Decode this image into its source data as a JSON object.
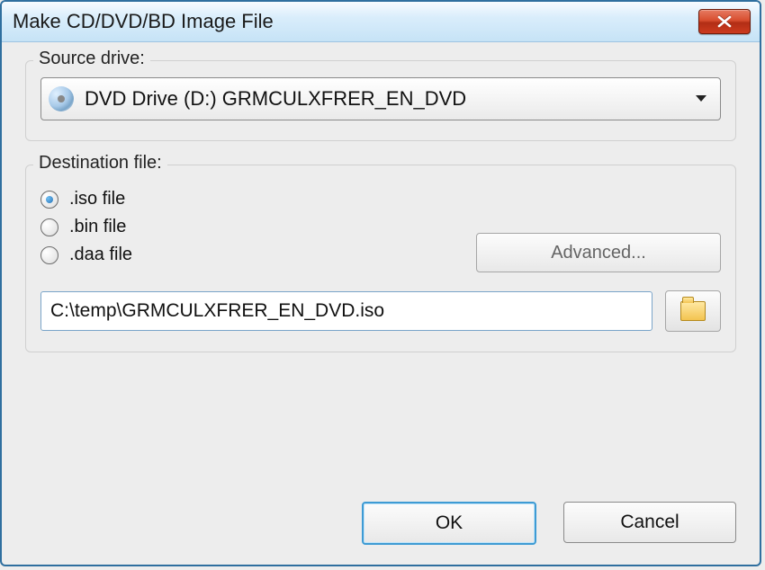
{
  "titlebar": {
    "title": "Make CD/DVD/BD Image File"
  },
  "source": {
    "legend": "Source drive:",
    "drive_text": "DVD Drive (D:) GRMCULXFRER_EN_DVD"
  },
  "dest": {
    "legend": "Destination file:",
    "radios": [
      {
        "label": ".iso file",
        "checked": true
      },
      {
        "label": ".bin file",
        "checked": false
      },
      {
        "label": ".daa file",
        "checked": false
      }
    ],
    "advanced_label": "Advanced...",
    "path_value": "C:\\temp\\GRMCULXFRER_EN_DVD.iso"
  },
  "footer": {
    "ok_label": "OK",
    "cancel_label": "Cancel"
  }
}
